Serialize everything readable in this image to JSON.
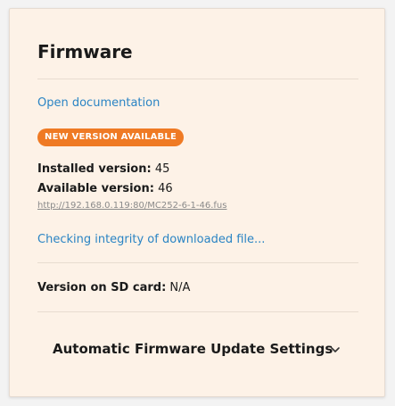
{
  "card": {
    "title": "Firmware",
    "doc_link": "Open documentation",
    "badge": "NEW VERSION AVAILABLE",
    "installed": {
      "label": "Installed version:",
      "value": "45"
    },
    "available": {
      "label": "Available version:",
      "value": "46"
    },
    "firmware_url": "http://192.168.0.119:80/MC252-6-1-46.fus",
    "status_text": "Checking integrity of downloaded file...",
    "sd_card": {
      "label": "Version on SD card:",
      "value": "N/A"
    },
    "accordion": {
      "label": "Automatic Firmware Update Settings",
      "icon": "chevron-down-icon"
    }
  },
  "colors": {
    "card_background": "#fdf2e7",
    "link": "#2a84c4",
    "badge": "#ef7a24",
    "text": "#1a1a1a"
  }
}
